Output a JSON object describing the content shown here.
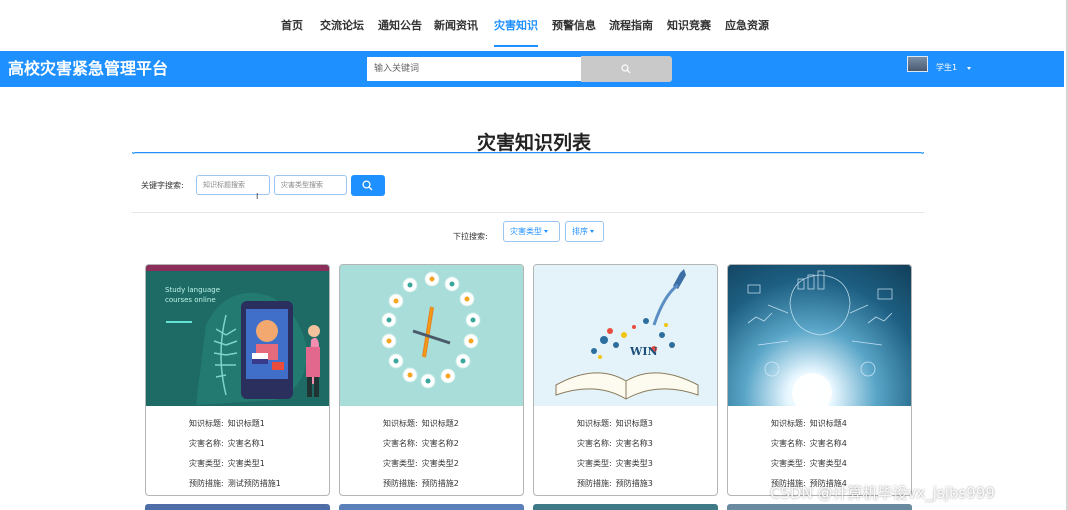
{
  "nav": {
    "items": [
      "首页",
      "交流论坛",
      "通知公告",
      "新闻资讯",
      "灾害知识",
      "预警信息",
      "流程指南",
      "知识竞赛",
      "应急资源"
    ],
    "active": "灾害知识"
  },
  "header": {
    "brand": "高校灾害紧急管理平台",
    "search_placeholder": "输入关键词",
    "username": "学生1"
  },
  "page": {
    "title": "灾害知识列表",
    "keyword_label": "关键字搜索:",
    "title_placeholder": "知识标题搜索",
    "type_placeholder": "灾害类型搜索",
    "dropdown_label": "下拉搜索:",
    "dropdown_type": "灾害类型",
    "dropdown_sort": "排序"
  },
  "cards": [
    {
      "labels": [
        "知识标题",
        "灾害名称",
        "灾害类型",
        "预防措施"
      ],
      "values": [
        "知识标题1",
        "灾害名称1",
        "灾害类型1",
        "测试预防措施1"
      ],
      "image_text": [
        "Study language",
        "courses online"
      ]
    },
    {
      "labels": [
        "知识标题",
        "灾害名称",
        "灾害类型",
        "预防措施"
      ],
      "values": [
        "知识标题2",
        "灾害名称2",
        "灾害类型2",
        "预防措施2"
      ]
    },
    {
      "labels": [
        "知识标题",
        "灾害名称",
        "灾害类型",
        "预防措施"
      ],
      "values": [
        "知识标题3",
        "灾害名称3",
        "灾害类型3",
        "预防措施3"
      ],
      "image_text": [
        "WIN"
      ]
    },
    {
      "labels": [
        "知识标题",
        "灾害名称",
        "灾害类型",
        "预防措施"
      ],
      "values": [
        "知识标题4",
        "灾害名称4",
        "灾害类型4",
        "预防措施4"
      ]
    }
  ],
  "watermark": "CSDN @计算机毕设vx_jsjbs999",
  "colors": {
    "accent": "#1e90ff",
    "search_button": "#c9c9c9"
  },
  "icons": [
    "search-icon",
    "chevron-down-icon",
    "avatar"
  ]
}
